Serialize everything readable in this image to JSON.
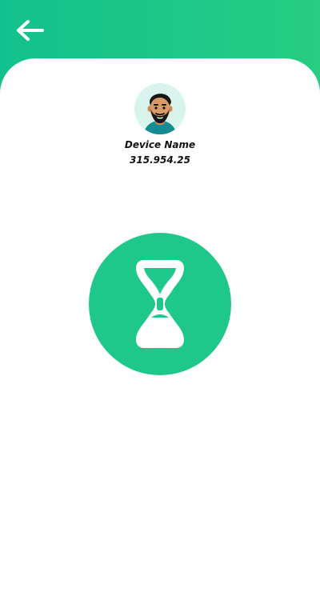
{
  "colors": {
    "header_start": "#12c18c",
    "header_end": "#27cd82",
    "accent": "#1ec88a",
    "avatar_bg": "#d9f4ec"
  },
  "header": {
    "back_icon": "arrow-left-icon"
  },
  "device": {
    "avatar_icon": "bearded-man-avatar-icon",
    "name": "Device Name",
    "id": "315.954.25"
  },
  "status": {
    "icon": "hourglass-icon"
  }
}
